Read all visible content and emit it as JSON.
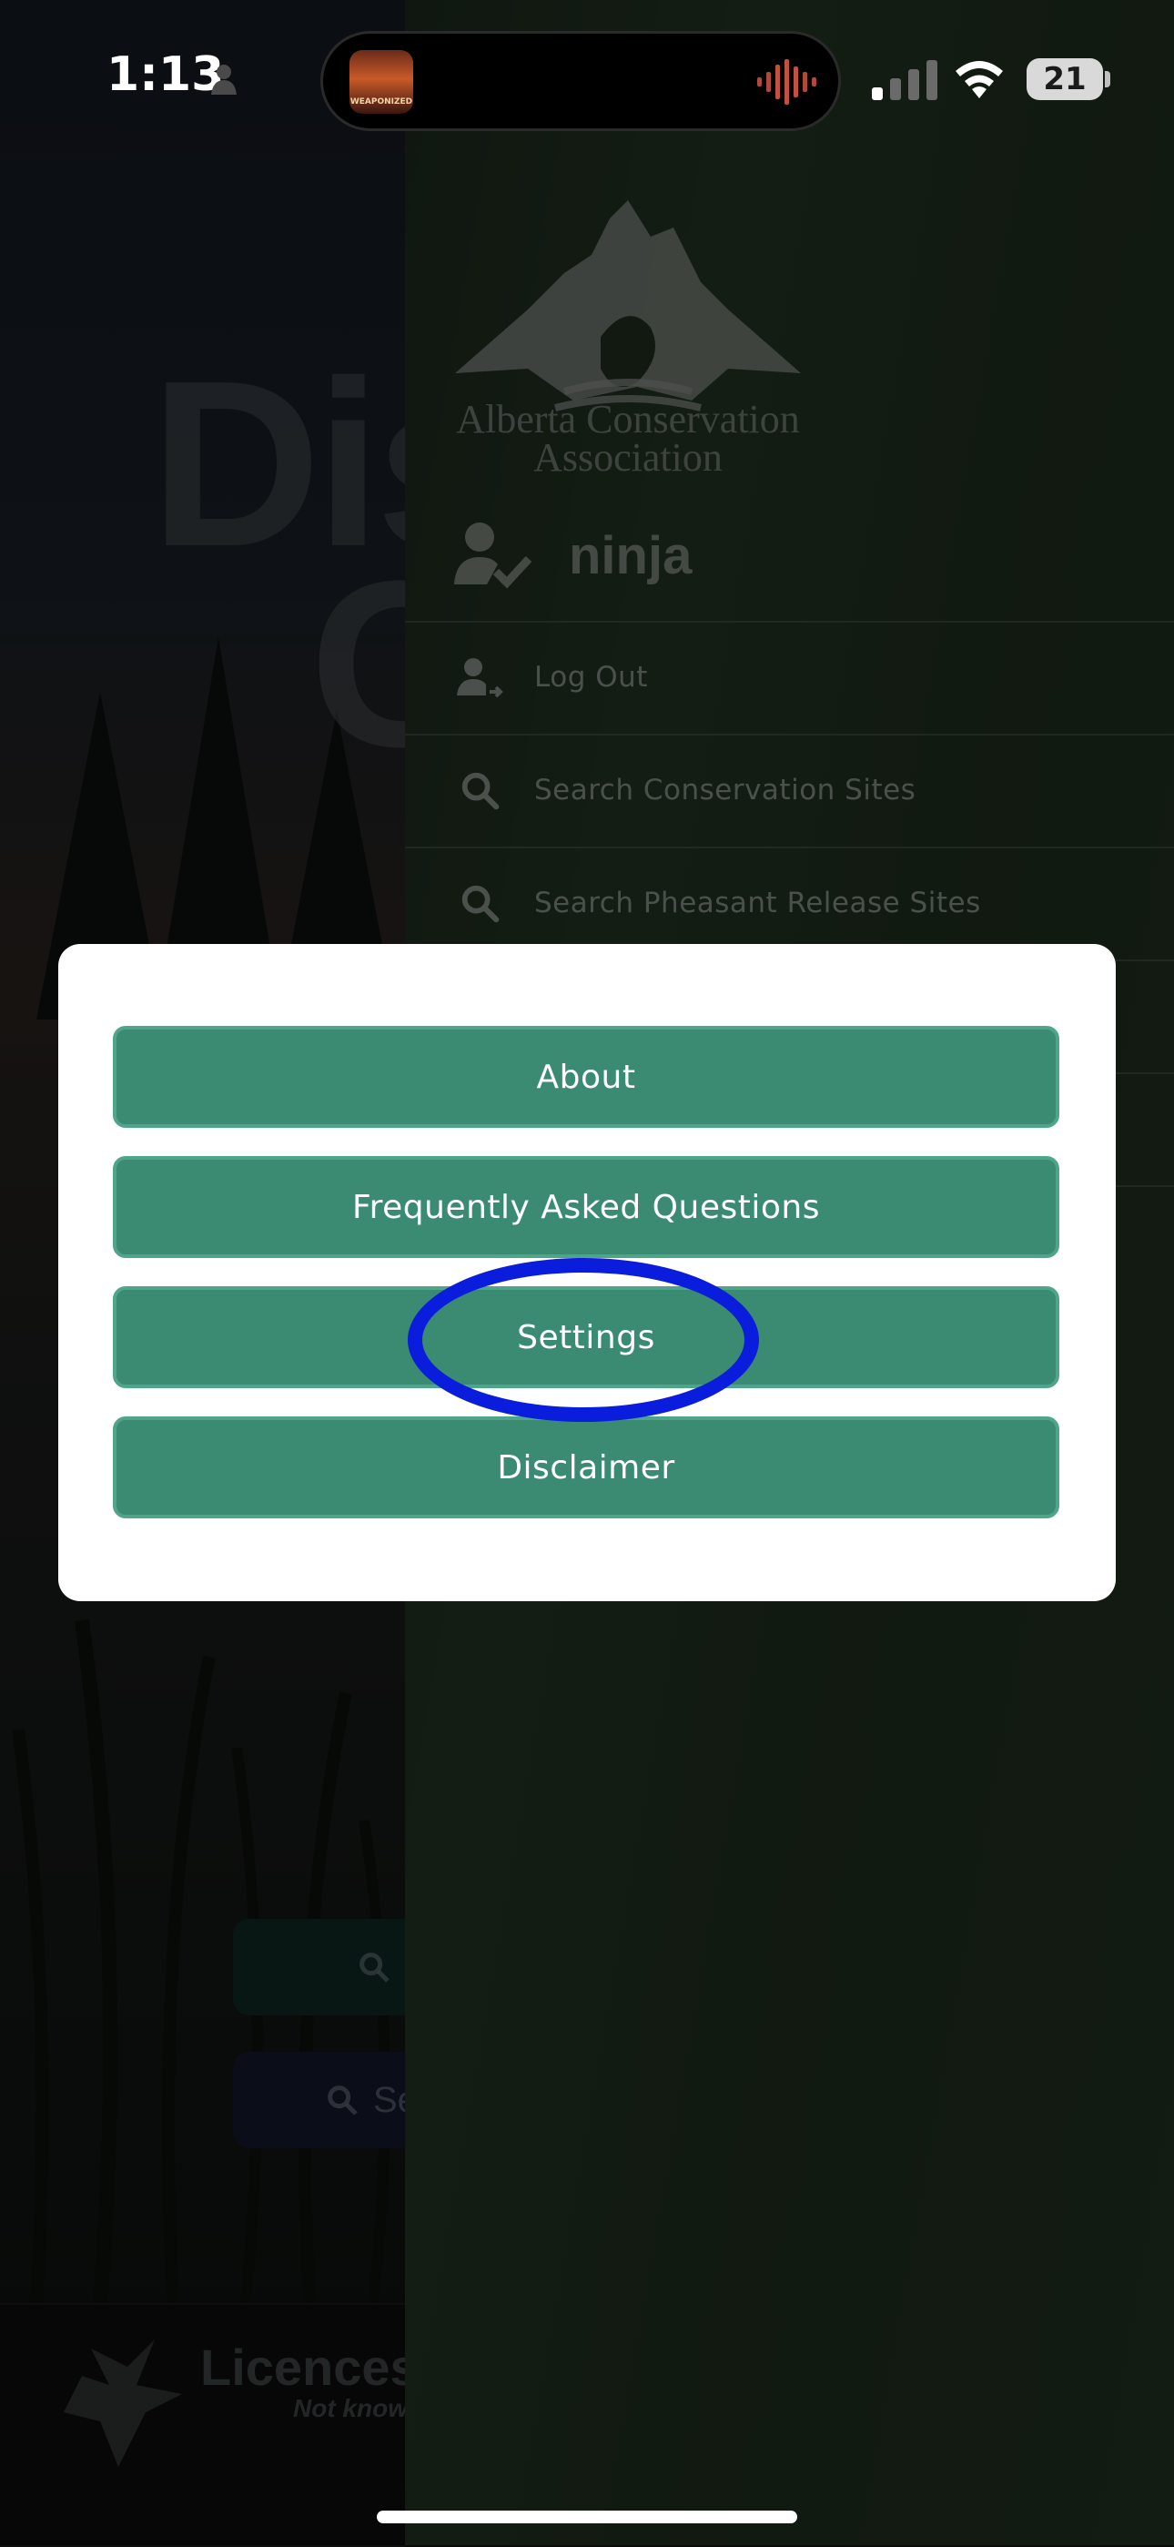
{
  "status_bar": {
    "time": "1:13",
    "battery": "21",
    "island_art_text": "WEAPONIZED"
  },
  "background_screen": {
    "title_line1": "Dis",
    "title_line2": "G",
    "button1_text": "",
    "button2_text": "Se",
    "footer_title": "Licences a",
    "footer_subtitle": "Not know"
  },
  "drawer": {
    "logo_text_line1": "Alberta Conservation",
    "logo_text_line2": "Association",
    "user_name": "ninja",
    "items": [
      {
        "label": "Log Out",
        "icon": "logout-icon"
      },
      {
        "label": "Search Conservation Sites",
        "icon": "search-icon"
      },
      {
        "label": "Search Pheasant Release Sites",
        "icon": "search-icon"
      }
    ]
  },
  "modal": {
    "buttons": [
      {
        "label": "About"
      },
      {
        "label": "Frequently Asked Questions"
      },
      {
        "label": "Settings"
      },
      {
        "label": "Disclaimer"
      }
    ]
  },
  "colors": {
    "button_green": "#3b8a72",
    "highlight_blue": "#0a1cdc"
  }
}
